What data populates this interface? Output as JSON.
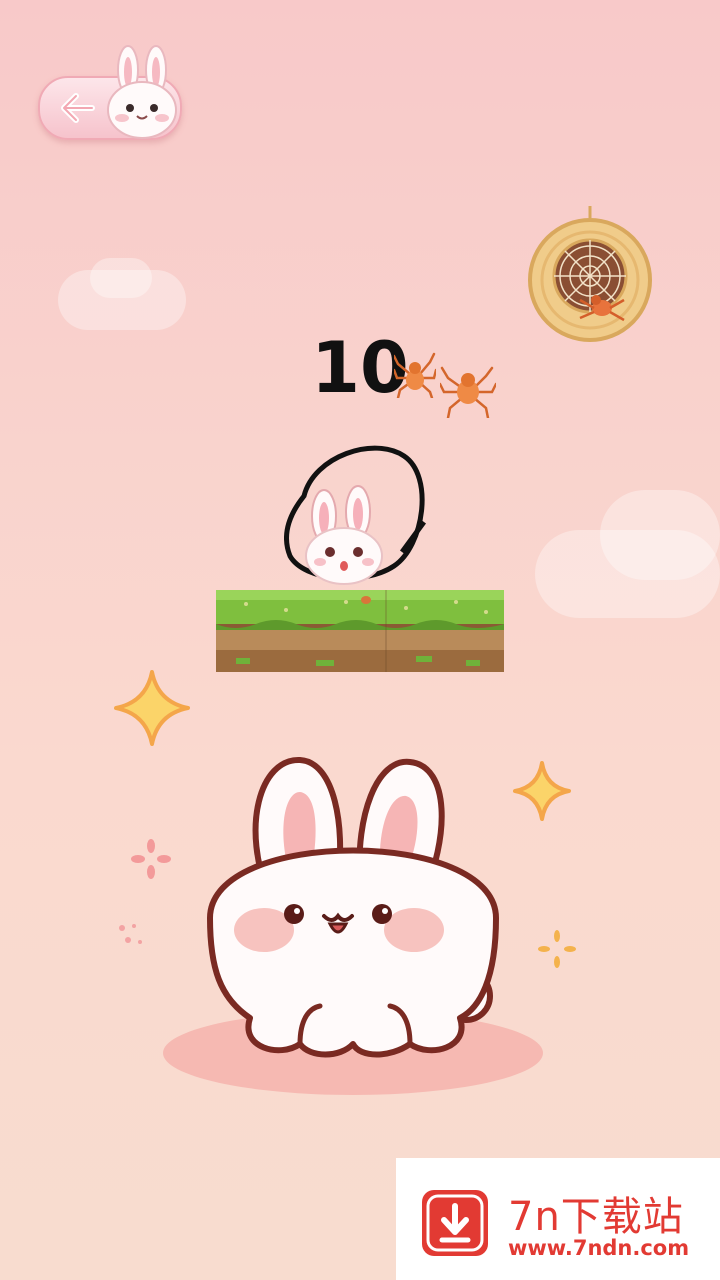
{
  "hud": {
    "score": "10",
    "back_button_icon": "left-arrow-icon"
  },
  "scene": {
    "hazard": "spider-web-ball",
    "enemies": [
      "spider",
      "spider"
    ],
    "player": "bunny",
    "platform": "grass-dirt-block",
    "mascot": "bunny-mascot"
  },
  "watermark": {
    "title": "7n下载站",
    "url": "www.7ndn.com",
    "icon": "download-icon"
  },
  "colors": {
    "background": "#f8c9c9",
    "accent": "#e23a33",
    "score_text": "#111111"
  }
}
